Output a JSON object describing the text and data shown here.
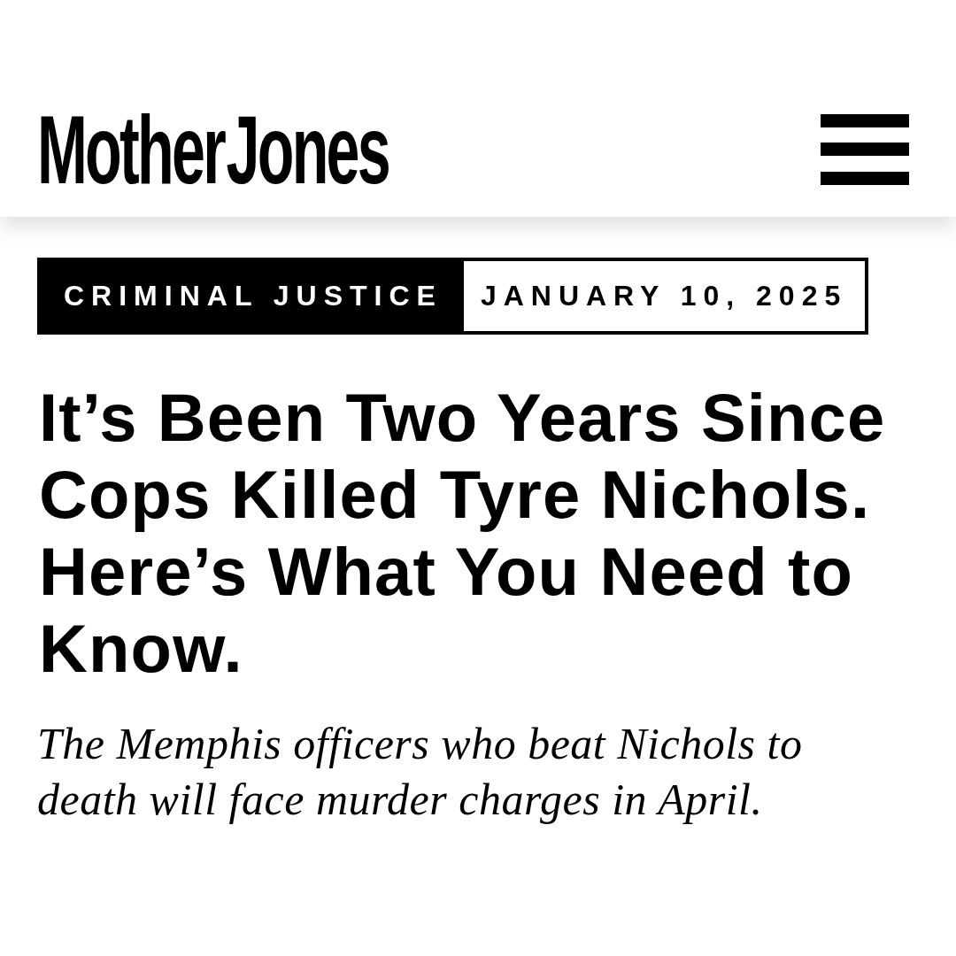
{
  "header": {
    "logo": "Mother Jones"
  },
  "meta": {
    "section": "CRIMINAL JUSTICE",
    "date": "JANUARY 10, 2025"
  },
  "article": {
    "headline": "It’s Been Two Years Since Cops Killed Tyre Nichols. Here’s What You Need to Know.",
    "dek": "The Memphis officers who beat Nichols to death will face murder charges in April."
  }
}
